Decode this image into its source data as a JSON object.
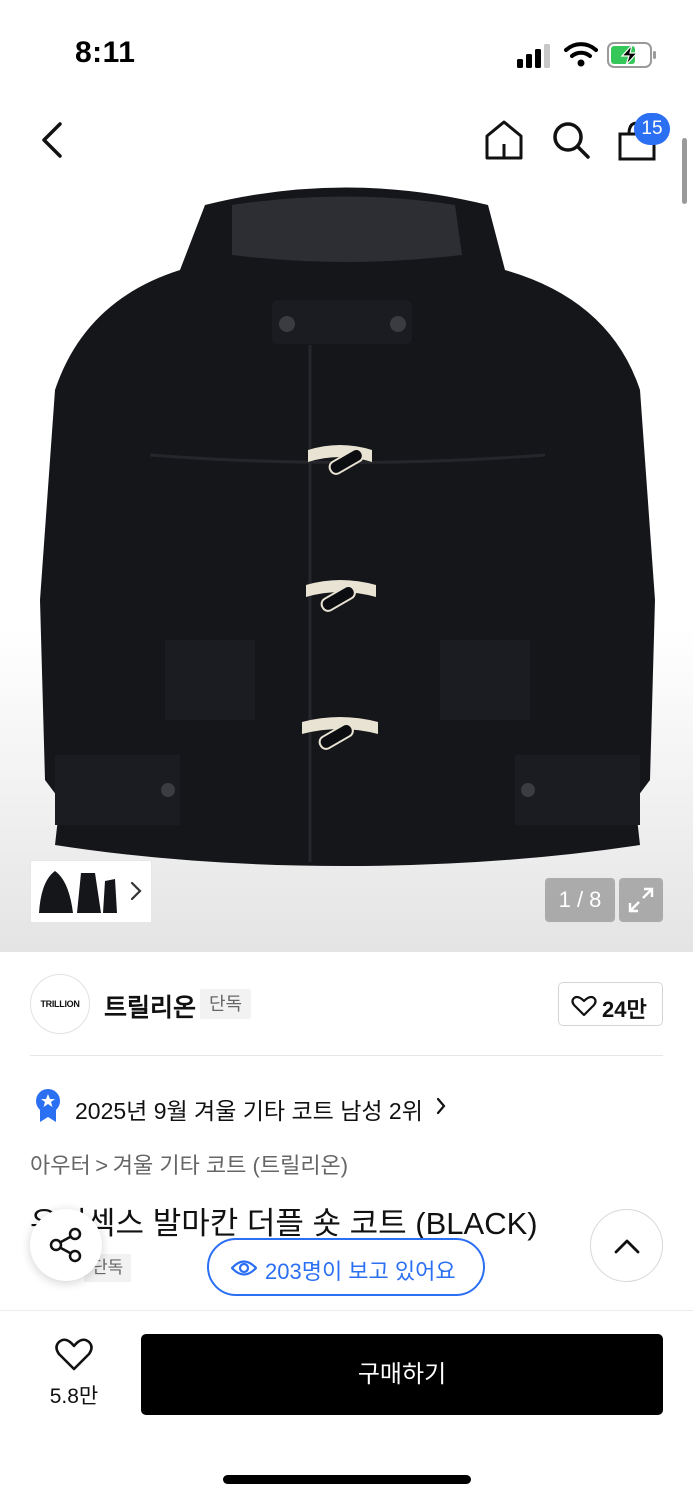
{
  "status_bar": {
    "time": "8:11"
  },
  "header": {
    "cart_count": "15"
  },
  "gallery": {
    "counter": "1 / 8"
  },
  "brand": {
    "logo_text": "TRILLION",
    "name": "트릴리온",
    "tag": "단독",
    "like_count": "24만"
  },
  "ranking": {
    "text": "2025년 9월 겨울 기타 코트 남성 2위"
  },
  "breadcrumb": {
    "items": [
      "아우터",
      "겨울 기타 코트 (트릴리온)"
    ],
    "separator": ">"
  },
  "product": {
    "title": "유니섹스 발마칸 더플 숏 코트 (BLACK)",
    "tag": "단독"
  },
  "viewers": {
    "text": "203명이 보고 있어요"
  },
  "bottom_bar": {
    "wish_count": "5.8만",
    "buy_label": "구매하기"
  },
  "colors": {
    "accent": "#2b6ff3",
    "buy_button": "#000000",
    "coat": "#15161a"
  }
}
